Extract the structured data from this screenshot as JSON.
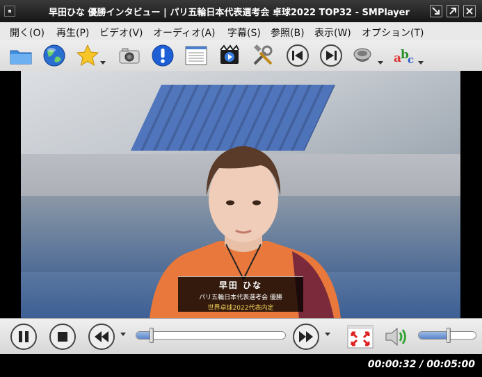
{
  "window": {
    "title": "早田ひな 優勝インタビュー | パリ五輪日本代表選考会 卓球2022 TOP32 - SMPlayer"
  },
  "menu": [
    {
      "label": "開く(O)"
    },
    {
      "label": "再生(P)"
    },
    {
      "label": "ビデオ(V)"
    },
    {
      "label": "オーディオ(A)"
    },
    {
      "label": "字幕(S)"
    },
    {
      "label": "参照(B)"
    },
    {
      "label": "表示(W)"
    },
    {
      "label": "オプション(T)"
    }
  ],
  "toolbar": {
    "icons": [
      "folder-icon",
      "globe-icon",
      "favorites-star-icon",
      "screenshot-camera-icon",
      "info-icon",
      "playlist-icon",
      "video-equalizer-icon",
      "preferences-tools-icon",
      "previous-icon",
      "next-icon",
      "audio-track-icon",
      "subtitle-icon"
    ]
  },
  "video_caption": {
    "name": "早田 ひな",
    "line2": "パリ五輪日本代表選考会 優勝",
    "line3": "世界卓球2022代表内定"
  },
  "playback": {
    "progress_fraction": 0.107,
    "volume_fraction": 0.52,
    "time_display": "00:00:32 / 00:05:00"
  },
  "colors": {
    "accent": "#5d86c9",
    "shirt": "#e9783c",
    "caption_highlight": "#f3d25a"
  }
}
